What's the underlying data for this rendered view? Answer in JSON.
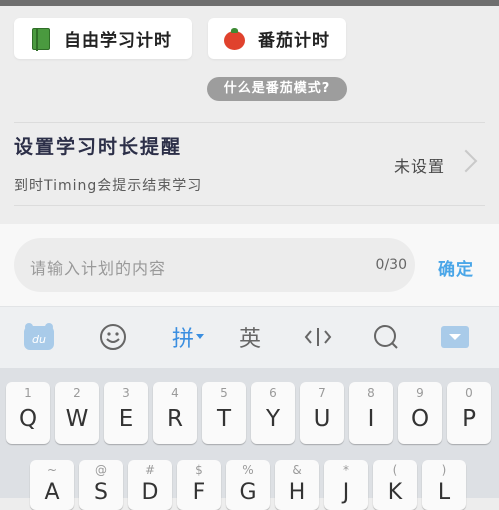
{
  "modes": {
    "free": {
      "label": "自由学习计时",
      "icon": "book-icon"
    },
    "pomodoro": {
      "label": "番茄计时",
      "icon": "tomato-icon"
    }
  },
  "pomodoro_help": "什么是番茄模式?",
  "reminder": {
    "title": "设置学习时长提醒",
    "subtitle": "到时Timing会提示结束学习",
    "value": "未设置"
  },
  "plan_input": {
    "placeholder": "请输入计划的内容",
    "counter": "0/30",
    "confirm": "确定"
  },
  "keyboard": {
    "toolbar": {
      "pinyin": "拼",
      "english": "英",
      "du_logo": "du"
    },
    "row1": [
      {
        "num": "1",
        "ch": "Q"
      },
      {
        "num": "2",
        "ch": "W"
      },
      {
        "num": "3",
        "ch": "E"
      },
      {
        "num": "4",
        "ch": "R"
      },
      {
        "num": "5",
        "ch": "T"
      },
      {
        "num": "6",
        "ch": "Y"
      },
      {
        "num": "7",
        "ch": "U"
      },
      {
        "num": "8",
        "ch": "I"
      },
      {
        "num": "9",
        "ch": "O"
      },
      {
        "num": "0",
        "ch": "P"
      }
    ],
    "row2": [
      {
        "num": "~",
        "ch": "A"
      },
      {
        "num": "@",
        "ch": "S"
      },
      {
        "num": "#",
        "ch": "D"
      },
      {
        "num": "$",
        "ch": "F"
      },
      {
        "num": "%",
        "ch": "G"
      },
      {
        "num": "&",
        "ch": "H"
      },
      {
        "num": "*",
        "ch": "J"
      },
      {
        "num": "(",
        "ch": "K"
      },
      {
        "num": ")",
        "ch": "L"
      }
    ]
  }
}
